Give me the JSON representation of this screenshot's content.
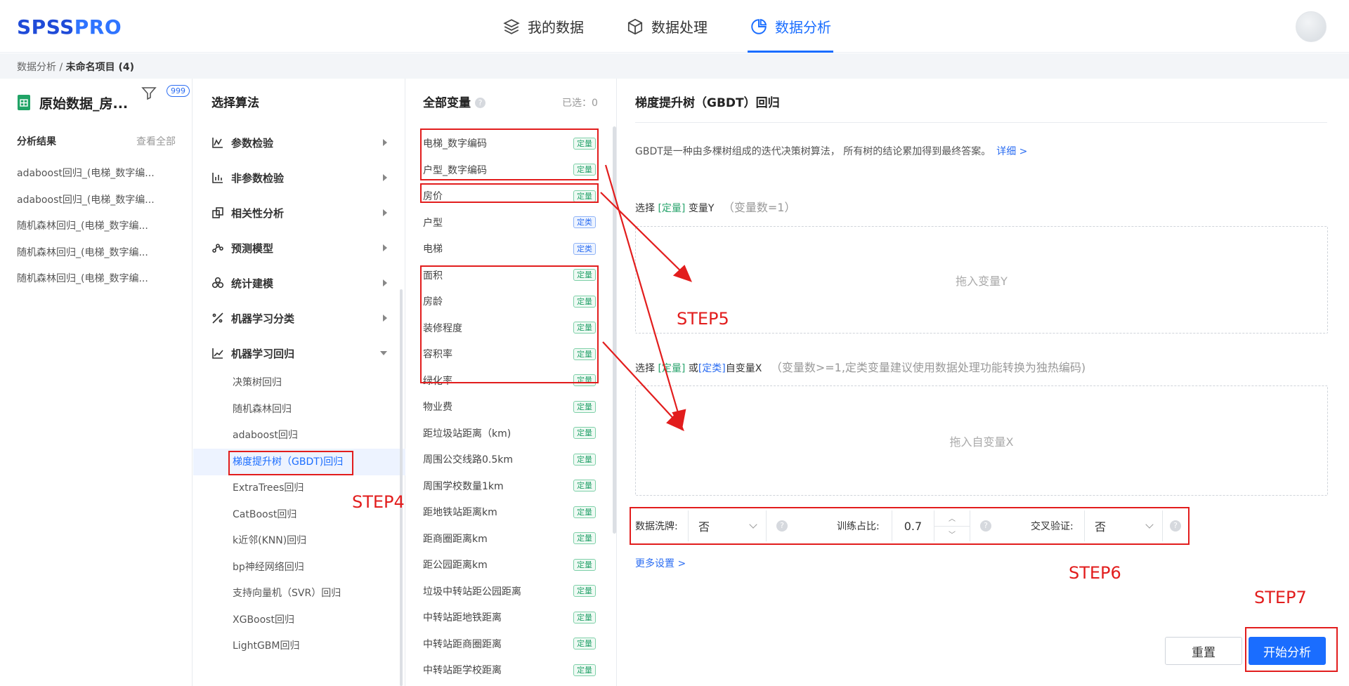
{
  "header": {
    "logo_part1": "SPSS",
    "logo_part2": "PRO",
    "tabs": [
      {
        "label": "我的数据",
        "icon": "layers-icon"
      },
      {
        "label": "数据处理",
        "icon": "cube-icon"
      },
      {
        "label": "数据分析",
        "icon": "pie-chart-icon",
        "active": true
      }
    ]
  },
  "breadcrumb": {
    "root": "数据分析",
    "separator": "/",
    "current": "未命名项目 (4)"
  },
  "file_panel": {
    "file_name": "原始数据_房...",
    "filter_badge": "999",
    "results_title": "分析结果",
    "view_all": "查看全部",
    "results": [
      "adaboost回归_(电梯_数字编...",
      "adaboost回归_(电梯_数字编...",
      "随机森林回归_(电梯_数字编...",
      "随机森林回归_(电梯_数字编...",
      "随机森林回归_(电梯_数字编..."
    ]
  },
  "algorithms": {
    "title": "选择算法",
    "categories": [
      {
        "label": "参数检验",
        "icon": "line-chart-icon"
      },
      {
        "label": "非参数检验",
        "icon": "bar-chart-icon"
      },
      {
        "label": "相关性分析",
        "icon": "correlation-icon"
      },
      {
        "label": "预测模型",
        "icon": "forecast-icon"
      },
      {
        "label": "统计建模",
        "icon": "cluster-icon"
      },
      {
        "label": "机器学习分类",
        "icon": "classify-icon"
      },
      {
        "label": "机器学习回归",
        "icon": "regression-icon",
        "expanded": true
      }
    ],
    "regression_items": [
      "决策树回归",
      "随机森林回归",
      "adaboost回归",
      "梯度提升树（GBDT)回归",
      "ExtraTrees回归",
      "CatBoost回归",
      "k近邻(KNN)回归",
      "bp神经网络回归",
      "支持向量机（SVR）回归",
      "XGBoost回归",
      "LightGBM回归"
    ],
    "active_index": 3
  },
  "variables": {
    "title": "全部变量",
    "help": "?",
    "selected": "已选：0",
    "items": [
      {
        "name": "电梯_数字编码",
        "type": "定量",
        "kind": "q"
      },
      {
        "name": "户型_数字编码",
        "type": "定量",
        "kind": "q"
      },
      {
        "name": "房价",
        "type": "定量",
        "kind": "q"
      },
      {
        "name": "户型",
        "type": "定类",
        "kind": "c"
      },
      {
        "name": "电梯",
        "type": "定类",
        "kind": "c"
      },
      {
        "name": "面积",
        "type": "定量",
        "kind": "q"
      },
      {
        "name": "房龄",
        "type": "定量",
        "kind": "q"
      },
      {
        "name": "装修程度",
        "type": "定量",
        "kind": "q"
      },
      {
        "name": "容积率",
        "type": "定量",
        "kind": "q"
      },
      {
        "name": "绿化率",
        "type": "定量",
        "kind": "q"
      },
      {
        "name": "物业费",
        "type": "定量",
        "kind": "q"
      },
      {
        "name": "距垃圾站距离（km)",
        "type": "定量",
        "kind": "q"
      },
      {
        "name": "周围公交线路0.5km",
        "type": "定量",
        "kind": "q"
      },
      {
        "name": "周围学校数量1km",
        "type": "定量",
        "kind": "q"
      },
      {
        "name": "距地铁站距离km",
        "type": "定量",
        "kind": "q"
      },
      {
        "name": "距商圈距离km",
        "type": "定量",
        "kind": "q"
      },
      {
        "name": "距公园距离km",
        "type": "定量",
        "kind": "q"
      },
      {
        "name": "垃圾中转站距公园距离",
        "type": "定量",
        "kind": "q"
      },
      {
        "name": "中转站距地铁距离",
        "type": "定量",
        "kind": "q"
      },
      {
        "name": "中转站距商圈距离",
        "type": "定量",
        "kind": "q"
      },
      {
        "name": "中转站距学校距离",
        "type": "定量",
        "kind": "q"
      }
    ]
  },
  "config": {
    "title": "梯度提升树（GBDT）回归",
    "description": "GBDT是一种由多棵树组成的迭代决策树算法， 所有树的结论累加得到最终答案。",
    "detail_link": "详细 >",
    "y_label_pre": "选择",
    "y_label_tag": "[定量]",
    "y_label_post": "变量Y",
    "y_hint": "（变量数=1）",
    "y_drop": "拖入变量Y",
    "x_label_pre": "选择",
    "x_label_tag1": "[定量]",
    "x_label_or": "或",
    "x_label_tag2": "[定类]",
    "x_label_post": "自变量X",
    "x_hint": "（变量数>=1,定类变量建议使用数据处理功能转换为独热编码)",
    "x_drop": "拖入自变量X",
    "shuffle_label": "数据洗牌:",
    "shuffle_value": "否",
    "train_ratio_label": "训练占比:",
    "train_ratio_value": "0.7",
    "cv_label": "交叉验证:",
    "cv_value": "否",
    "help": "?",
    "more_settings": "更多设置 >",
    "reset": "重置",
    "start": "开始分析"
  },
  "annotations": {
    "step4": "STEP4",
    "step5": "STEP5",
    "step6": "STEP6",
    "step7": "STEP7",
    "color": "#e21d1d"
  },
  "colors": {
    "primary": "#1a6dff",
    "quant_tag": "#27a36b",
    "cat_tag": "#2b6df2"
  }
}
